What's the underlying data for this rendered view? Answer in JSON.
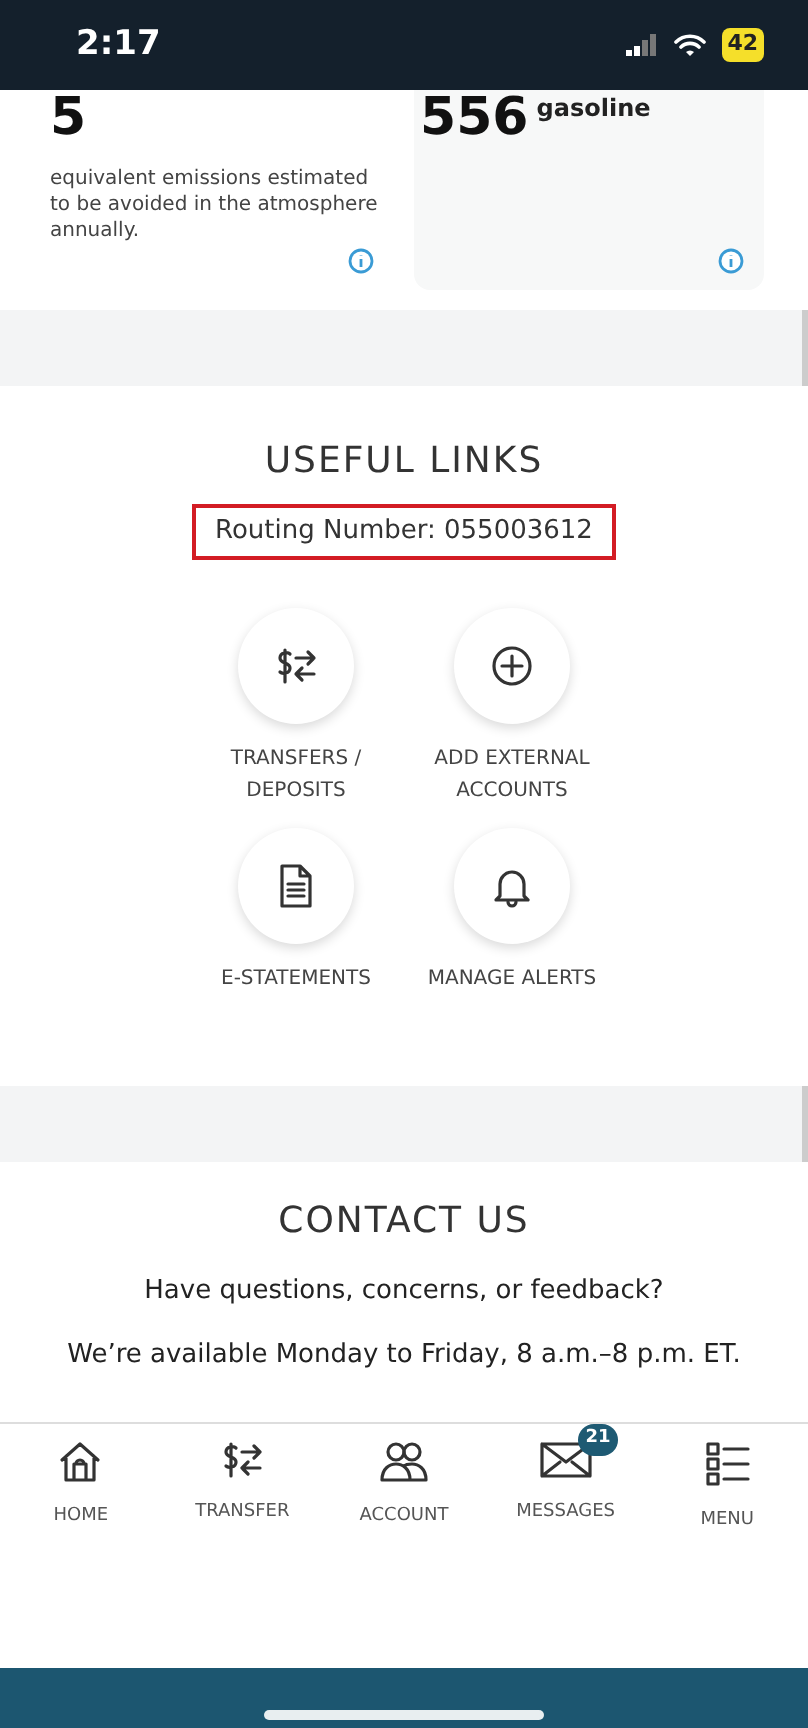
{
  "status_bar": {
    "time": "2:17",
    "battery": "42"
  },
  "impact_cards": [
    {
      "value": "5",
      "description": "equivalent emissions estimated to be avoided in the atmosphere annually."
    },
    {
      "value": "556",
      "unit": "gasoline"
    }
  ],
  "useful_links": {
    "title": "USEFUL LINKS",
    "routing_number": "Routing Number: 055003612",
    "links": [
      {
        "label": "TRANSFERS / DEPOSITS"
      },
      {
        "label": "ADD EXTERNAL ACCOUNTS"
      },
      {
        "label": "E-STATEMENTS"
      },
      {
        "label": "MANAGE ALERTS"
      }
    ]
  },
  "contact": {
    "title": "CONTACT US",
    "question": "Have questions, concerns, or feedback?",
    "hours": "We’re available Monday to Friday, 8 a.m.–8 p.m. ET."
  },
  "bottom_nav": [
    {
      "label": "HOME"
    },
    {
      "label": "TRANSFER"
    },
    {
      "label": "ACCOUNT"
    },
    {
      "label": "MESSAGES",
      "badge": "21"
    },
    {
      "label": "MENU"
    }
  ]
}
